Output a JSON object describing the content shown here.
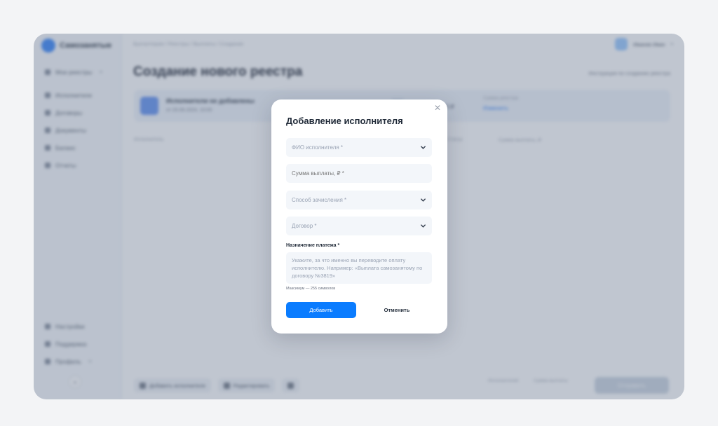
{
  "app": {
    "brand": "Самозанятые",
    "breadcrumb": "Бухгалтерия / Реестры / Выплаты / Создание",
    "user_name": "Иванов Иван",
    "page_title": "Создание нового реестра",
    "header_link": "Инструкция по созданию реестра",
    "info": {
      "title": "Исполнители не добавлены",
      "subtitle": "от 20.06.2024, 10:00",
      "label": "Сумма реестра",
      "value": "0 ₽",
      "fragment": "0 ₽",
      "edit": "Изменить"
    },
    "columns": [
      "Исполнитель",
      "Статус",
      "Сумма выплаты, ₽"
    ],
    "sidebar_main": [
      "Мои реестры",
      "Исполнители",
      "Договоры",
      "Документы",
      "Баланс",
      "Отчеты"
    ],
    "sidebar_bottom": [
      "Настройки",
      "Поддержка",
      "Профиль"
    ],
    "bottom_buttons": [
      "Добавить исполнителя",
      "Редактировать"
    ],
    "bottom_stats": [
      "Исполнителей",
      "Сумма выплаты"
    ],
    "bottom_primary": "Отправить"
  },
  "modal": {
    "title": "Добавление исполнителя",
    "close_icon": "close-icon",
    "fields": {
      "executor_placeholder": "ФИО исполнителя *",
      "amount_placeholder": "Сумма выплаты, ₽ *",
      "method_placeholder": "Способ зачисления *",
      "contract_placeholder": "Договор *"
    },
    "purpose_label": "Назначение платежа *",
    "purpose_placeholder": "Укажите, за что именно вы переводите оплату исполнителю. Например: «Выплата самозанятому по договору №3819»",
    "hint": "Максимум — 255 символов",
    "add_button": "Добавить",
    "cancel_button": "Отменить"
  },
  "colors": {
    "accent": "#0a7cff",
    "overlay": "#6a788e"
  }
}
